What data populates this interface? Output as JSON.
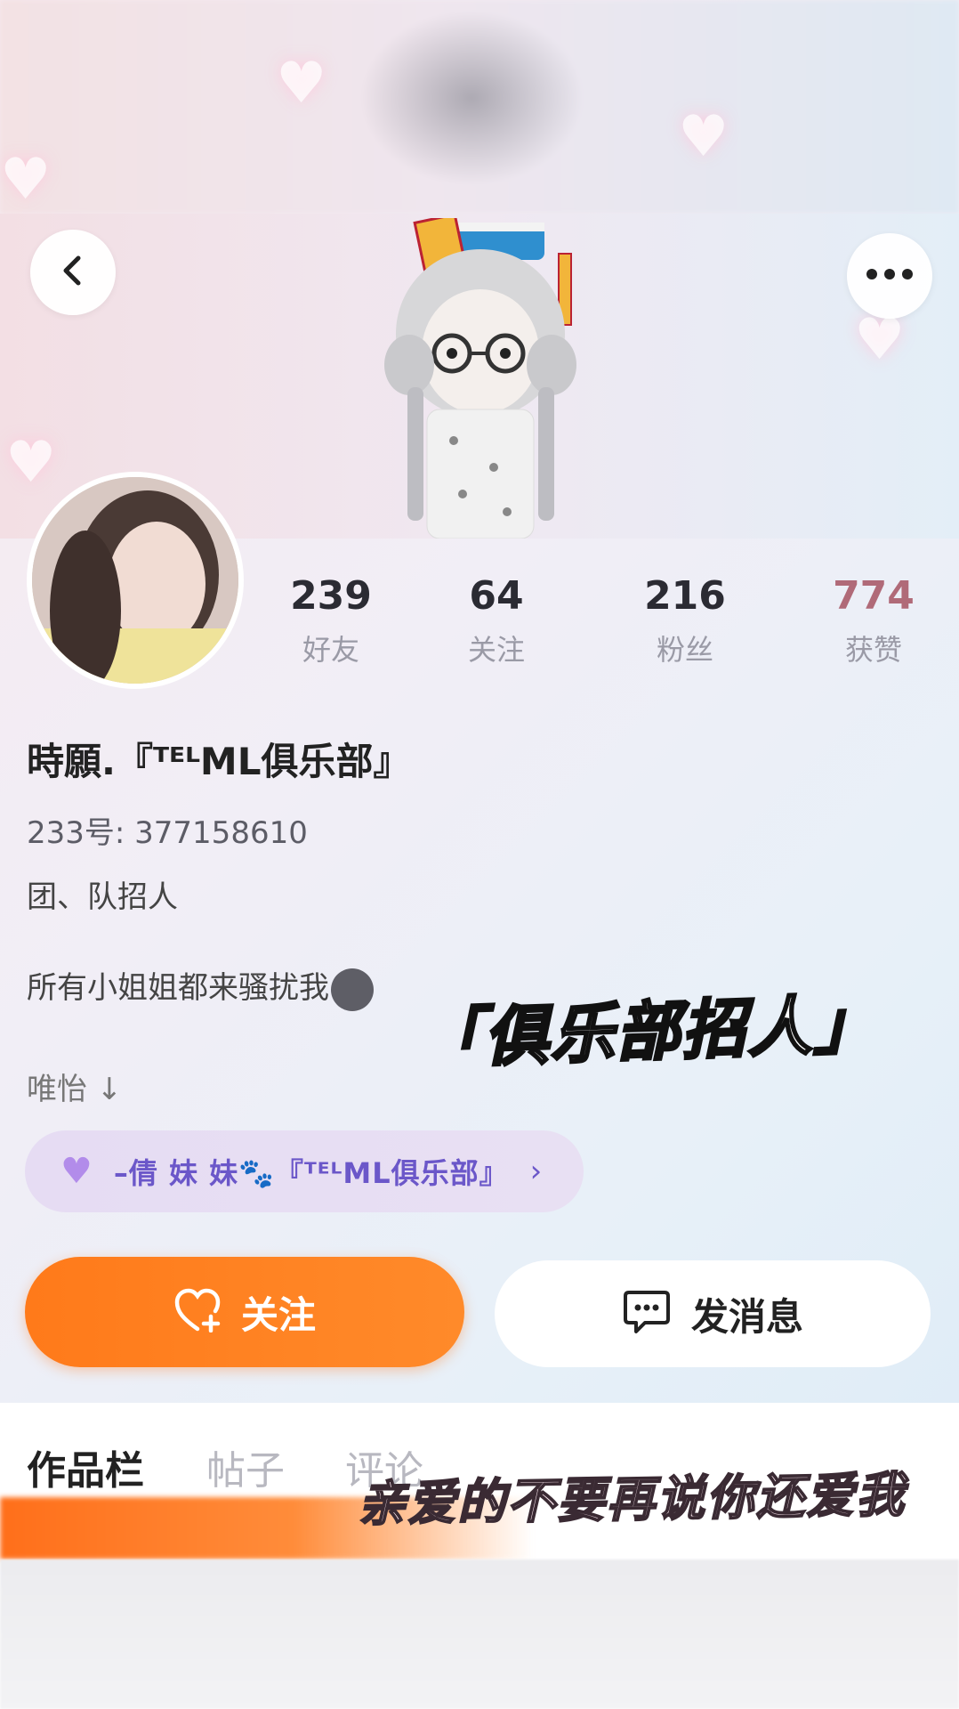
{
  "profile": {
    "name": "時願.『ᵀᴱᴸML俱乐部』",
    "uid": "233号: 377158610",
    "bio_lines": [
      "团、队招人",
      "所有小姐姐都来骚扰我",
      "唯怡 ↓"
    ]
  },
  "stats": [
    {
      "value": "239",
      "label": "好友"
    },
    {
      "value": "64",
      "label": "关注"
    },
    {
      "value": "216",
      "label": "粉丝"
    },
    {
      "value": "774",
      "label": "获赞"
    }
  ],
  "cp_link": {
    "text": "–倩 妹 妹🐾『ᵀᴱᴸML俱乐部』",
    "arrow": "›"
  },
  "buttons": {
    "follow": "关注",
    "message": "发消息"
  },
  "tabs": [
    "作品栏",
    "帖子",
    "评论"
  ],
  "overlays": {
    "title": "「俱乐部招人」",
    "lyric": "亲爱的不要再说你还爱我"
  },
  "icons": {
    "back": "chevron-left-icon",
    "more": "more-horizontal-icon",
    "follow": "heart-plus-icon",
    "message": "chat-bubble-icon",
    "cp": "purple-heart-icon"
  },
  "colors": {
    "accent": "#ff7a1a",
    "cp_text": "#6b57c9",
    "likes": "#b06a78"
  }
}
